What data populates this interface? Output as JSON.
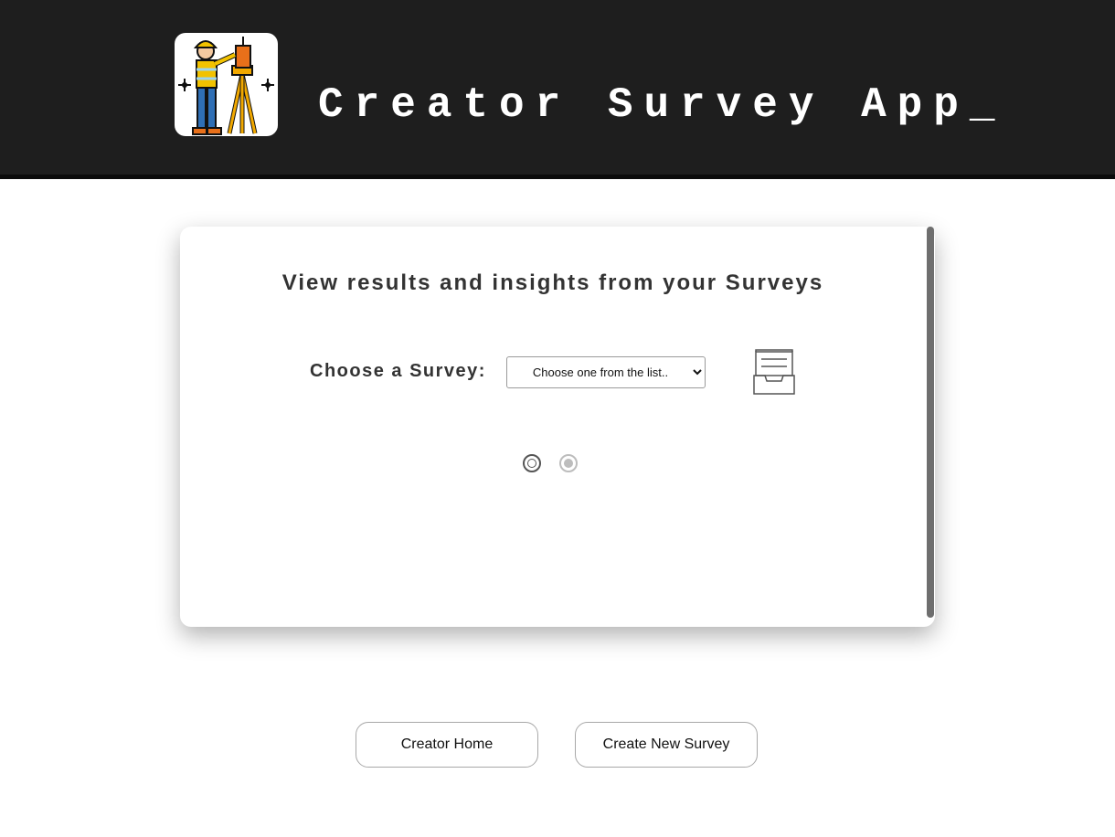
{
  "header": {
    "app_title": "Creator Survey App_"
  },
  "card": {
    "heading": "View results and insights from your Surveys",
    "choose_label": "Choose a Survey:",
    "survey_select": {
      "selected": "Choose one from the list.."
    }
  },
  "icons": {
    "logo": "surveyor-logo-icon",
    "inbox": "inbox-tray-icon"
  },
  "pager": {
    "current_page": 1,
    "total_pages": 2
  },
  "buttons": {
    "creator_home": "Creator Home",
    "create_new_survey": "Create New Survey"
  },
  "colors": {
    "header_bg": "#1e1e1e",
    "header_text": "#ffffff",
    "heading_text": "#333333",
    "scrollbar_thumb": "#6e6e6e"
  }
}
